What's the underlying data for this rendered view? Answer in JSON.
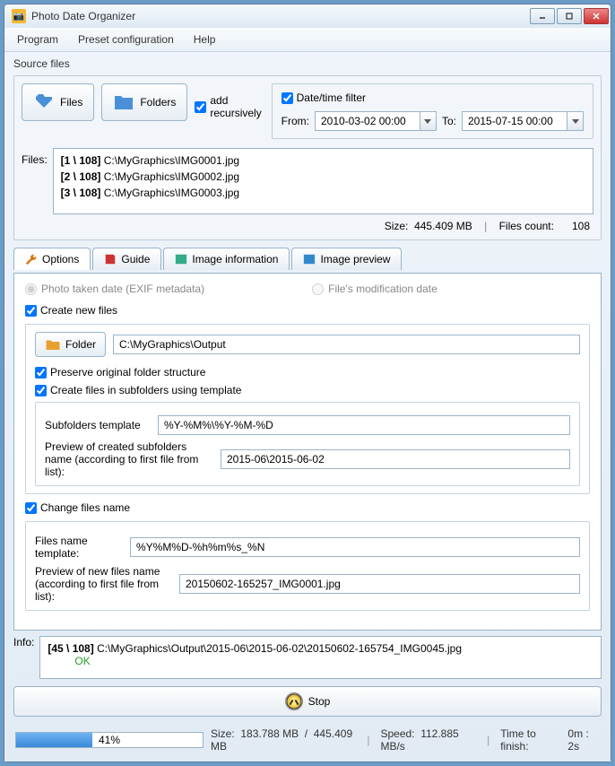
{
  "window": {
    "title": "Photo Date Organizer"
  },
  "menu": {
    "program": "Program",
    "preset": "Preset configuration",
    "help": "Help"
  },
  "source": {
    "label": "Source files",
    "files_btn": "Files",
    "folders_btn": "Folders",
    "add_recursively": "add recursively",
    "date_filter": "Date/time filter",
    "from": "From:",
    "to": "To:",
    "from_val": "2010-03-02 00:00",
    "to_val": "2015-07-15 00:00",
    "files_label": "Files:",
    "rows": [
      {
        "idx": "[1 \\ 108]",
        "path": "C:\\MyGraphics\\IMG0001.jpg"
      },
      {
        "idx": "[2 \\ 108]",
        "path": "C:\\MyGraphics\\IMG0002.jpg"
      },
      {
        "idx": "[3 \\ 108]",
        "path": "C:\\MyGraphics\\IMG0003.jpg"
      }
    ],
    "size_label": "Size:",
    "size_val": "445.409 MB",
    "count_label": "Files count:",
    "count_val": "108"
  },
  "tabs": {
    "options": "Options",
    "guide": "Guide",
    "imginfo": "Image information",
    "imgprev": "Image preview"
  },
  "options": {
    "radio_exif": "Photo taken date (EXIF metadata)",
    "radio_mod": "File's modification date",
    "create_new": "Create new files",
    "folder_btn": "Folder",
    "folder_path": "C:\\MyGraphics\\Output",
    "preserve": "Preserve original folder structure",
    "subfolders_cb": "Create files in subfolders using template",
    "subtpl_label": "Subfolders template",
    "subtpl_val": "%Y-%M%\\%Y-%M-%D",
    "subprev_label": "Preview of created subfolders name (according to first file from list):",
    "subprev_val": "2015-06\\2015-06-02",
    "change_cb": "Change files name",
    "fntpl_label": "Files name template:",
    "fntpl_val": "%Y%M%D-%h%m%s_%N",
    "fnprev_label": "Preview of new files name (according to first file from list):",
    "fnprev_val": "20150602-165257_IMG0001.jpg"
  },
  "info": {
    "label": "Info:",
    "idx": "[45 \\ 108]",
    "path": "C:\\MyGraphics\\Output\\2015-06\\2015-06-02\\20150602-165754_IMG0045.jpg",
    "status": "OK"
  },
  "stop": "Stop",
  "status": {
    "pct": "41%",
    "pct_val": 41,
    "size_label": "Size:",
    "size_cur": "183.788 MB",
    "size_tot": "445.409 MB",
    "speed_label": "Speed:",
    "speed_val": "112.885 MB/s",
    "time_label": "Time to finish:",
    "time_val": "0m : 2s"
  }
}
